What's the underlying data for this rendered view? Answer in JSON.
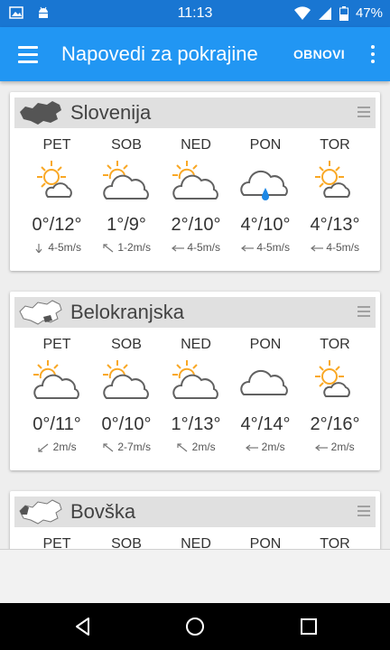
{
  "status_bar": {
    "time": "11:13",
    "battery": "47%"
  },
  "app_bar": {
    "title": "Napovedi za pokrajine",
    "action": "OBNOVI"
  },
  "regions": [
    {
      "name": "Slovenija",
      "days": [
        {
          "day": "PET",
          "icon": "sun-cloud-icon",
          "temp": "0°/12°",
          "wind": "4-5m/s",
          "wind_dir": "down"
        },
        {
          "day": "SOB",
          "icon": "sun-behind-cloud-icon",
          "temp": "1°/9°",
          "wind": "1-2m/s",
          "wind_dir": "up-left"
        },
        {
          "day": "NED",
          "icon": "sun-behind-cloud-icon",
          "temp": "2°/10°",
          "wind": "4-5m/s",
          "wind_dir": "left"
        },
        {
          "day": "PON",
          "icon": "cloud-rain-icon",
          "temp": "4°/10°",
          "wind": "4-5m/s",
          "wind_dir": "left"
        },
        {
          "day": "TOR",
          "icon": "sun-cloud-icon",
          "temp": "4°/13°",
          "wind": "4-5m/s",
          "wind_dir": "left"
        }
      ]
    },
    {
      "name": "Belokranjska",
      "days": [
        {
          "day": "PET",
          "icon": "sun-behind-cloud-icon",
          "temp": "0°/11°",
          "wind": "2m/s",
          "wind_dir": "down-left"
        },
        {
          "day": "SOB",
          "icon": "sun-behind-cloud-icon",
          "temp": "0°/10°",
          "wind": "2-7m/s",
          "wind_dir": "up-left"
        },
        {
          "day": "NED",
          "icon": "sun-behind-cloud-icon",
          "temp": "1°/13°",
          "wind": "2m/s",
          "wind_dir": "up-left"
        },
        {
          "day": "PON",
          "icon": "cloud-icon",
          "temp": "4°/14°",
          "wind": "2m/s",
          "wind_dir": "left"
        },
        {
          "day": "TOR",
          "icon": "sun-cloud-icon",
          "temp": "2°/16°",
          "wind": "2m/s",
          "wind_dir": "left"
        }
      ]
    },
    {
      "name": "Bovška",
      "days": [
        {
          "day": "PET"
        },
        {
          "day": "SOB"
        },
        {
          "day": "NED"
        },
        {
          "day": "PON"
        },
        {
          "day": "TOR"
        }
      ]
    }
  ],
  "colors": {
    "primary": "#2196F3",
    "primary_dark": "#1976D2",
    "sun": "#F9A825",
    "cloud": "#616161",
    "rain": "#1E88E5"
  }
}
